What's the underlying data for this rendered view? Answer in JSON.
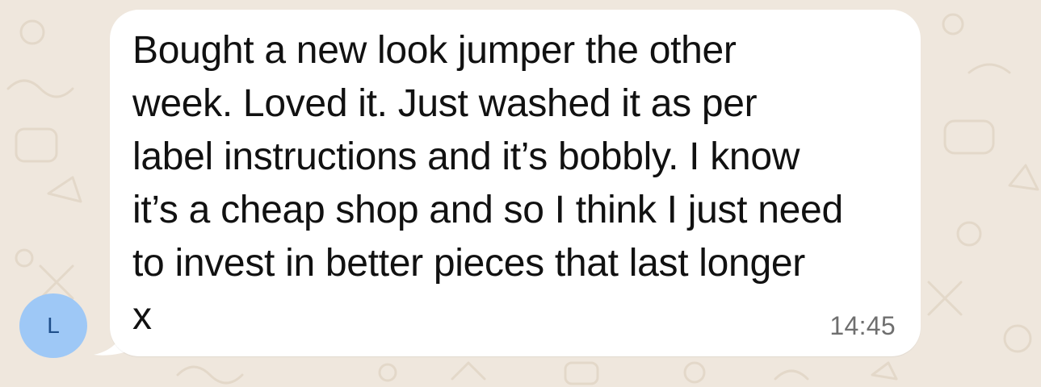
{
  "chat": {
    "sender_avatar_initial": "L",
    "message": {
      "text": "Bought a new look jumper the other\nweek. Loved it. Just washed it as per\nlabel instructions and it’s bobbly. I know\nit’s a cheap shop and so I think I just need\nto invest in better pieces that last longer\nx",
      "time": "14:45"
    }
  },
  "colors": {
    "wallpaper": "#efe7dd",
    "bubble": "#ffffff",
    "avatar_bg": "#9ec8f6",
    "avatar_text": "#1f4f8a",
    "message_text": "#111111",
    "timestamp_text": "#6f6f6f"
  }
}
